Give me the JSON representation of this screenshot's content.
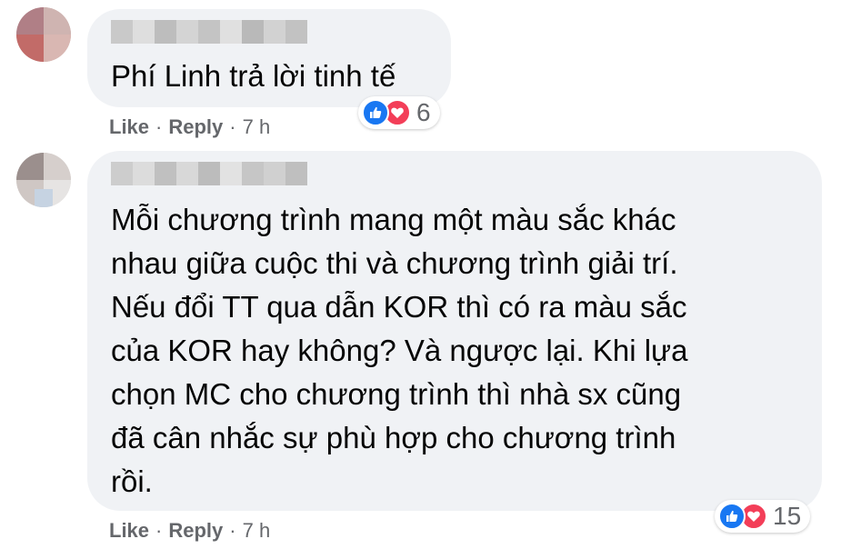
{
  "comments": [
    {
      "text": "Phí Linh trả lời tinh tế",
      "actions": {
        "like": "Like",
        "reply": "Reply",
        "separator": "·",
        "time": "7 h"
      },
      "reactions": {
        "icons": [
          "like-icon",
          "love-icon"
        ],
        "count": "6"
      }
    },
    {
      "text": "Mỗi chương trình mang một màu sắc khác\nnhau giữa cuộc thi và chương trình giải trí.\nNếu đổi TT qua dẫn KOR thì có ra màu sắc\ncủa KOR hay không? Và ngược lại. Khi lựa\nchọn MC cho chương trình thì nhà sx cũng\nđã cân nhắc sự phù hợp cho chương trình\nrồi.",
      "actions": {
        "like": "Like",
        "reply": "Reply",
        "separator": "·",
        "time": "7 h"
      },
      "reactions": {
        "icons": [
          "like-icon",
          "love-icon"
        ],
        "count": "15"
      }
    }
  ],
  "colors": {
    "bubble": "#f0f2f5",
    "text": "#050505",
    "meta": "#65676b",
    "like": "#1877f2",
    "love": "#f33e58"
  }
}
